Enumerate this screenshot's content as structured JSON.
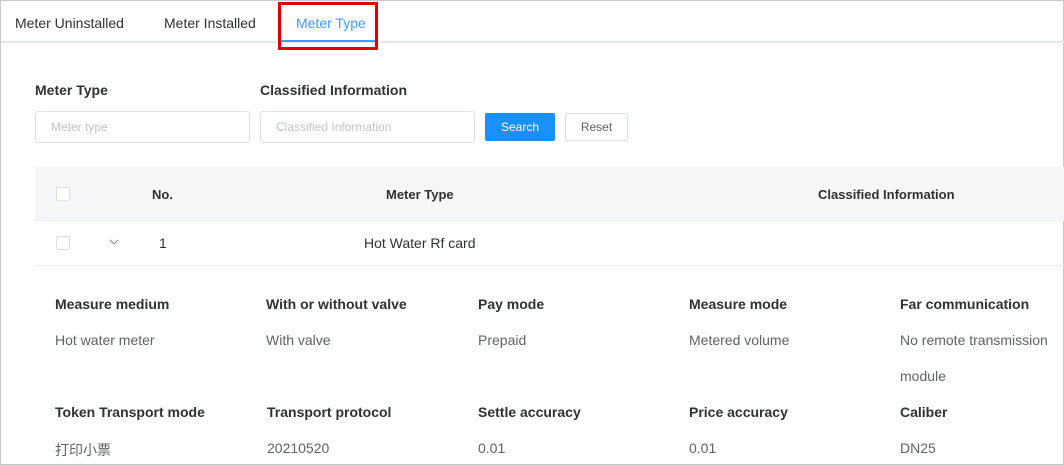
{
  "tabs": [
    {
      "label": "Meter Uninstalled"
    },
    {
      "label": "Meter Installed"
    },
    {
      "label": "Meter Type"
    }
  ],
  "filters": {
    "meter_type_label": "Meter Type",
    "meter_type_placeholder": "Meter type",
    "classified_label": "Classified Information",
    "classified_placeholder": "Classified Information",
    "search_button": "Search",
    "reset_button": "Reset"
  },
  "table": {
    "headers": {
      "no": "No.",
      "meter_type": "Meter Type",
      "classified": "Classified Information"
    },
    "rows": [
      {
        "no": "1",
        "meter_type": "Hot Water Rf card",
        "classified": ""
      }
    ]
  },
  "detail": {
    "fields": [
      {
        "label": "Measure medium",
        "value": "Hot water meter"
      },
      {
        "label": "With or without valve",
        "value": "With valve"
      },
      {
        "label": "Pay mode",
        "value": "Prepaid"
      },
      {
        "label": "Measure mode",
        "value": "Metered volume"
      },
      {
        "label": "Far communication",
        "value": "No remote transmission",
        "value2": "module"
      },
      {
        "label": "Token Transport mode",
        "value": "打印小票"
      },
      {
        "label": "Transport protocol",
        "value": "20210520"
      },
      {
        "label": "Settle accuracy",
        "value": "0.01"
      },
      {
        "label": "Price accuracy",
        "value": "0.01"
      },
      {
        "label": "Caliber",
        "value": "DN25"
      }
    ]
  },
  "colors": {
    "accent": "#409eff",
    "primary_button": "#1890ff",
    "highlight": "#e00000"
  }
}
